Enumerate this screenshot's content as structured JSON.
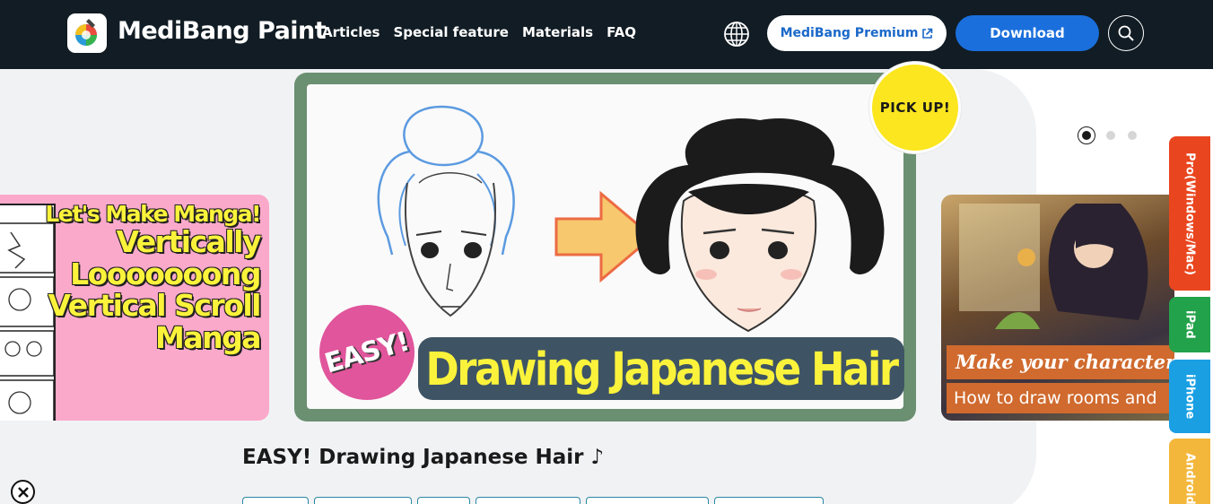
{
  "header": {
    "brand": "MediBang Paint",
    "nav": [
      {
        "label": "Articles"
      },
      {
        "label": "Special feature"
      },
      {
        "label": "Materials"
      },
      {
        "label": "FAQ"
      }
    ],
    "premium_label": "MediBang Premium",
    "download_label": "Download",
    "icons": {
      "globe": "globe-icon",
      "search": "search-icon",
      "external": "external-link-icon"
    }
  },
  "hero": {
    "left_slide": {
      "lines": [
        "Let's Make Manga!",
        "Vertically",
        "Looooooong",
        "Vertical Scroll",
        "Manga"
      ]
    },
    "main_slide": {
      "badge": "EASY!",
      "title": "Drawing Japanese Hair",
      "pickup": "PICK UP!"
    },
    "right_slide": {
      "line1": "Make your characters",
      "line2": "How to draw rooms and"
    },
    "dots": {
      "count": 3,
      "active": 0
    }
  },
  "side_tabs": [
    {
      "label": "Pro(Windows/Mac)",
      "color": "#e9461f"
    },
    {
      "label": "iPad",
      "color": "#22a24a"
    },
    {
      "label": "iPhone",
      "color": "#1a9fe3"
    },
    {
      "label": "Android",
      "color": "#f3b73b"
    }
  ],
  "article": {
    "title": "EASY! Drawing Japanese Hair ♪"
  },
  "colors": {
    "header_bg": "#111c24",
    "download_blue": "#1a6fdc",
    "premium_text": "#1a68c9",
    "frame_green": "#6a8f71",
    "title_yellow": "#fbf33b"
  }
}
